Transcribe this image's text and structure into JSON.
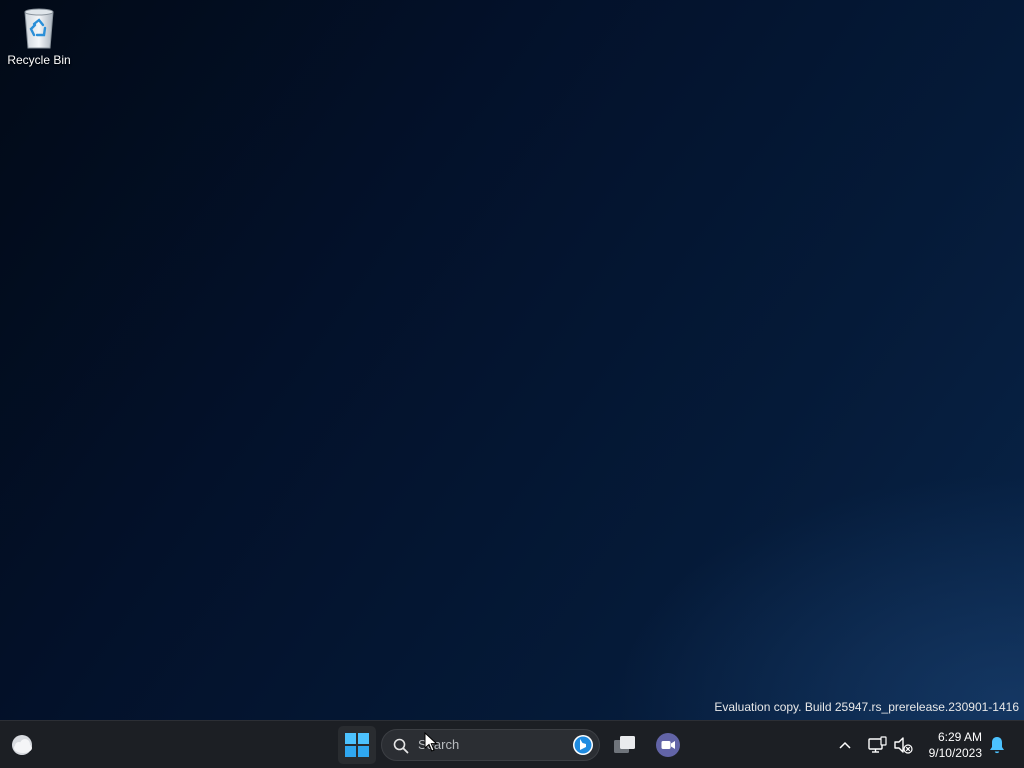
{
  "desktop": {
    "icons": [
      {
        "label": "Recycle Bin",
        "icon": "recycle-bin-icon"
      }
    ],
    "watermark": "Evaluation copy. Build 25947.rs_prerelease.230901-1416"
  },
  "taskbar": {
    "widgets_icon": "weather-cloud-icon",
    "start_icon": "windows-logo-icon",
    "search": {
      "placeholder": "Search",
      "icon": "search-icon",
      "bing_icon": "bing-icon"
    },
    "apps": [
      {
        "name": "Task View",
        "icon": "task-view-icon"
      },
      {
        "name": "Teams Chat",
        "icon": "teams-chat-icon"
      }
    ],
    "tray": {
      "chevron_icon": "chevron-up-icon",
      "network_icon": "network-icon",
      "volume_icon": "volume-muted-icon",
      "time": "6:29 AM",
      "date": "9/10/2023",
      "notification_icon": "bell-icon"
    }
  },
  "colors": {
    "accent_blue": "#4cc2ff",
    "taskbar_bg": "#1c1f24",
    "teams_purple": "#6264a7"
  }
}
